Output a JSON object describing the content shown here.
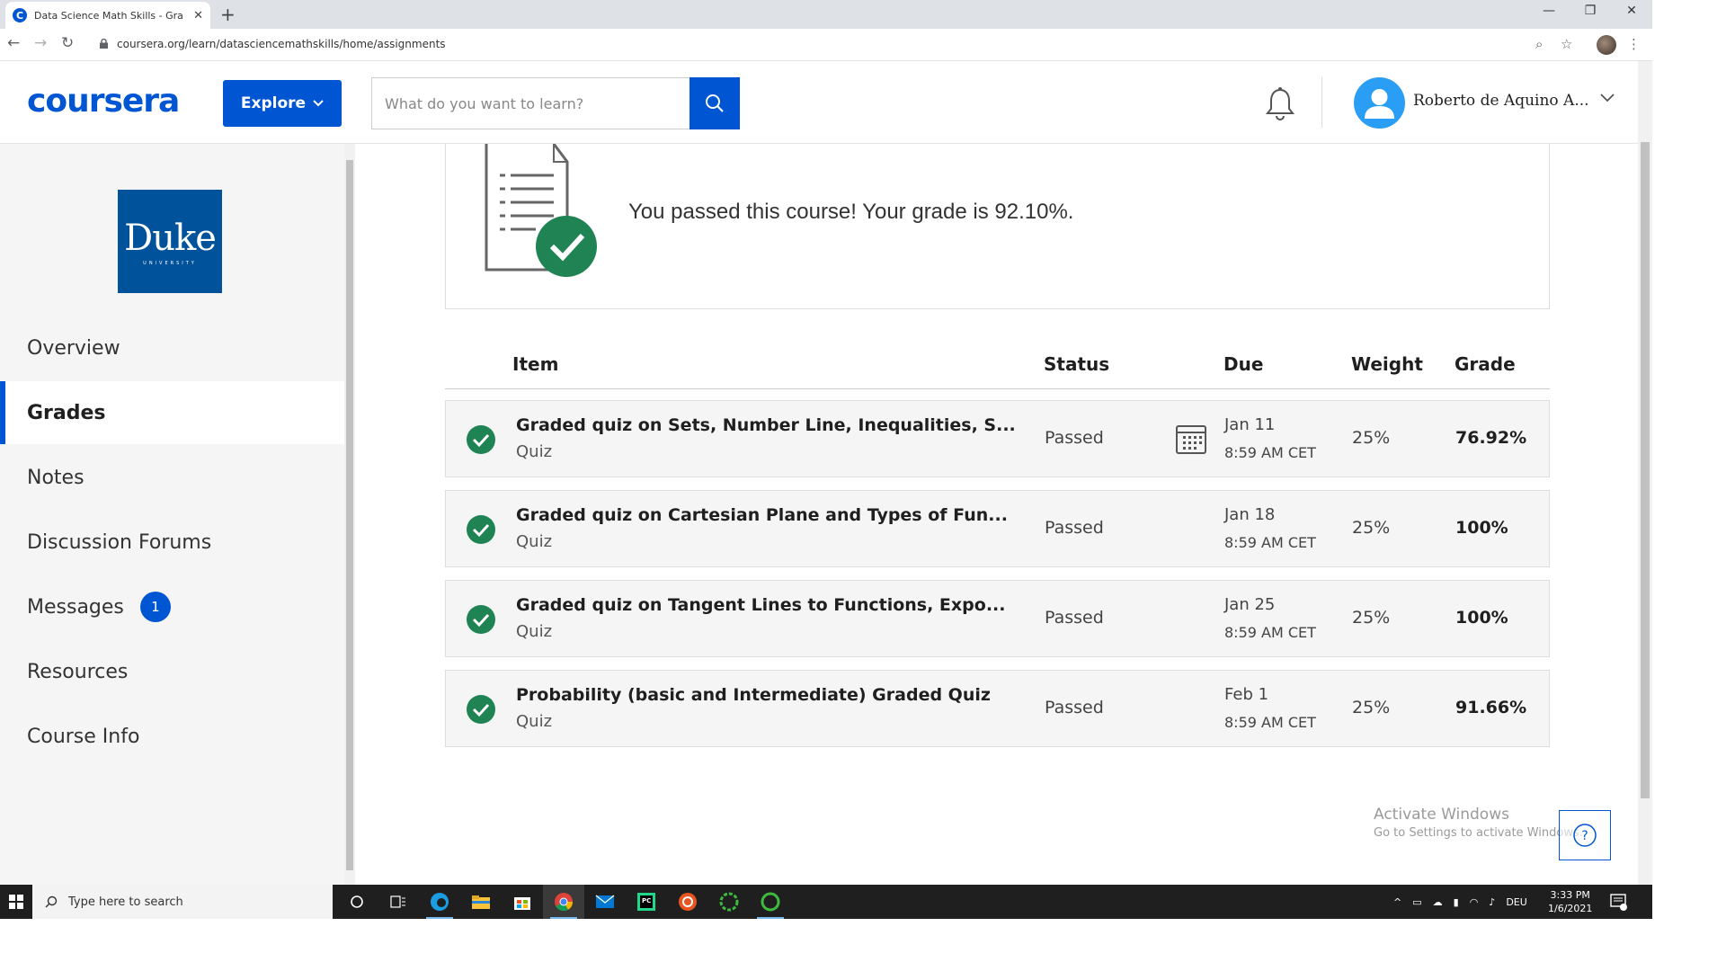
{
  "browser": {
    "tab_title": "Data Science Math Skills - Grades",
    "tab_favicon_letter": "C",
    "url": "coursera.org/learn/datasciencemathskills/home/assignments"
  },
  "header": {
    "logo": "coursera",
    "explore_label": "Explore",
    "search_placeholder": "What do you want to learn?",
    "user_name": "Roberto de Aquino A..."
  },
  "sidebar": {
    "university_logo": {
      "word": "Duke",
      "sub": "UNIVERSITY"
    },
    "items": [
      {
        "label": "Overview"
      },
      {
        "label": "Grades"
      },
      {
        "label": "Notes"
      },
      {
        "label": "Discussion Forums"
      },
      {
        "label": "Messages",
        "badge": "1"
      },
      {
        "label": "Resources"
      },
      {
        "label": "Course Info"
      }
    ],
    "active_item": "Grades"
  },
  "main": {
    "pass_message": "You passed this course! Your grade is 92.10%.",
    "columns": {
      "item": "Item",
      "status": "Status",
      "due": "Due",
      "weight": "Weight",
      "grade": "Grade"
    },
    "rows": [
      {
        "title": "Graded quiz on Sets, Number Line, Inequalities, S...",
        "type": "Quiz",
        "status": "Passed",
        "due_date": "Jan 11",
        "due_time": "8:59 AM CET",
        "weight": "25%",
        "grade": "76.92%"
      },
      {
        "title": "Graded quiz on Cartesian Plane and Types of Fun...",
        "type": "Quiz",
        "status": "Passed",
        "due_date": "Jan 18",
        "due_time": "8:59 AM CET",
        "weight": "25%",
        "grade": "100%"
      },
      {
        "title": "Graded quiz on Tangent Lines to Functions, Expo...",
        "type": "Quiz",
        "status": "Passed",
        "due_date": "Jan 25",
        "due_time": "8:59 AM CET",
        "weight": "25%",
        "grade": "100%"
      },
      {
        "title": "Probability (basic and Intermediate) Graded Quiz",
        "type": "Quiz",
        "status": "Passed",
        "due_date": "Feb 1",
        "due_time": "8:59 AM CET",
        "weight": "25%",
        "grade": "91.66%"
      }
    ],
    "activate_windows": {
      "title": "Activate Windows",
      "subtitle": "Go to Settings to activate Windows."
    },
    "help_label": "?"
  },
  "taskbar": {
    "search_placeholder": "Type here to search",
    "language": "DEU",
    "time": "3:33 PM",
    "date": "1/6/2021"
  },
  "colors": {
    "brand_blue": "#0056d2",
    "success_green": "#1f8354",
    "sidebar_bg": "#f5f5f5",
    "duke_blue": "#00539b"
  }
}
